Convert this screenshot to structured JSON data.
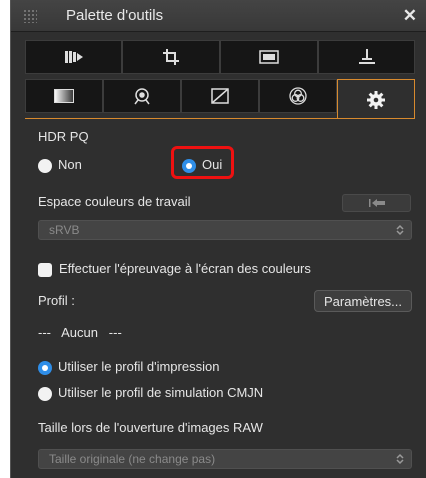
{
  "window": {
    "title": "Palette d'outils",
    "close_glyph": "✕"
  },
  "tabs_row1": [
    {
      "icon": "histogram-icon"
    },
    {
      "icon": "crop-icon"
    },
    {
      "icon": "image-adjust-icon"
    },
    {
      "icon": "stamp-icon"
    }
  ],
  "tabs_row2": [
    {
      "icon": "gradient-icon"
    },
    {
      "icon": "loupe-icon"
    },
    {
      "icon": "curve-icon"
    },
    {
      "icon": "color-wheel-icon"
    },
    {
      "icon": "gear-icon",
      "active": true
    }
  ],
  "panel": {
    "hdr_label": "HDR PQ",
    "hdr_options": [
      {
        "label": "Non",
        "selected": false
      },
      {
        "label": "Oui",
        "selected": true
      }
    ],
    "workspace_label": "Espace couleurs de travail",
    "workspace_value": "sRVB",
    "proof_label": "Effectuer l'épreuvage à l'écran des couleurs",
    "profile_label": "Profil :",
    "params_button": "Paramètres...",
    "profile_value": "---   Aucun   ---",
    "profile_options": [
      {
        "label": "Utiliser le profil d'impression",
        "selected": true
      },
      {
        "label": "Utiliser le profil de simulation CMJN",
        "selected": false
      }
    ],
    "raw_size_label": "Taille lors de l'ouverture d'images RAW",
    "raw_size_value": "Taille originale (ne change pas)"
  },
  "colors": {
    "accent": "#d88a2e",
    "selection": "#2f8ee8",
    "highlight": "#ee1111",
    "background": "#2f2f2f"
  }
}
